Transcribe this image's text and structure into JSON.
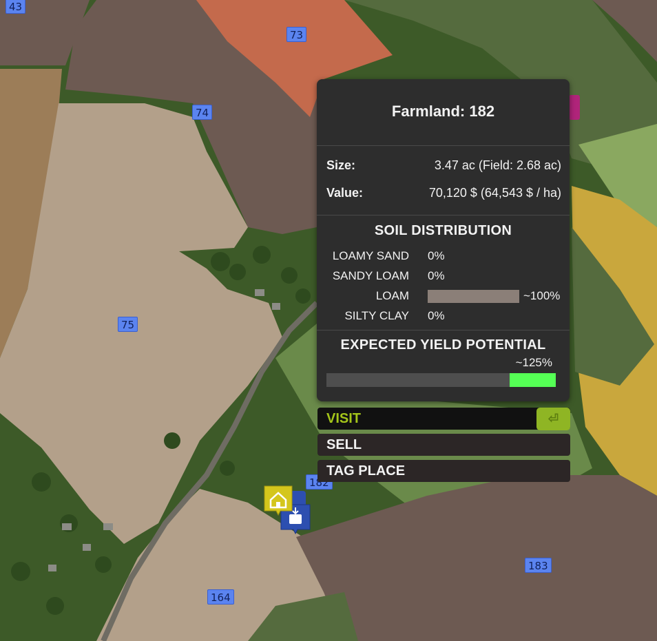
{
  "map": {
    "field_labels": [
      {
        "id": "field-43",
        "text": "43"
      },
      {
        "id": "field-73",
        "text": "73"
      },
      {
        "id": "field-74",
        "text": "74"
      },
      {
        "id": "field-75",
        "text": "75"
      },
      {
        "id": "field-182",
        "text": "182"
      },
      {
        "id": "field-183",
        "text": "183"
      },
      {
        "id": "field-164",
        "text": "164"
      }
    ],
    "colors": {
      "forest": "#3d5a28",
      "grass": "#556b3e",
      "soil_dark": "#6d5a52",
      "soil_light": "#b3a08a",
      "red_field": "#c46a4c",
      "yellow_field": "#c9a73d",
      "green_field": "#6a8a4a"
    }
  },
  "panel": {
    "title": "Farmland: 182",
    "size_label": "Size:",
    "size_value": "3.47 ac (Field: 2.68 ac)",
    "value_label": "Value:",
    "value_value": "70,120 $ (64,543 $ / ha)",
    "soil_title": "SOIL DISTRIBUTION",
    "soils": [
      {
        "name": "LOAMY SAND",
        "pct_label": "0%",
        "fraction": 0
      },
      {
        "name": "SANDY LOAM",
        "pct_label": "0%",
        "fraction": 0
      },
      {
        "name": "LOAM",
        "pct_label": "~100%",
        "fraction": 1.0
      },
      {
        "name": "SILTY CLAY",
        "pct_label": "0%",
        "fraction": 0
      }
    ],
    "yield_title": "EXPECTED YIELD POTENTIAL",
    "yield_label": "~125%",
    "yield_fill_fraction": 0.2,
    "yield_color": "#55ff55"
  },
  "actions": {
    "visit": "VISIT",
    "sell": "SELL",
    "tag_place": "TAG PLACE",
    "enter_icon": "enter-key-icon",
    "enter_glyph": "⏎"
  },
  "poi": {
    "home_icon": "home-icon",
    "shop_icon": "sell-point-icon"
  }
}
